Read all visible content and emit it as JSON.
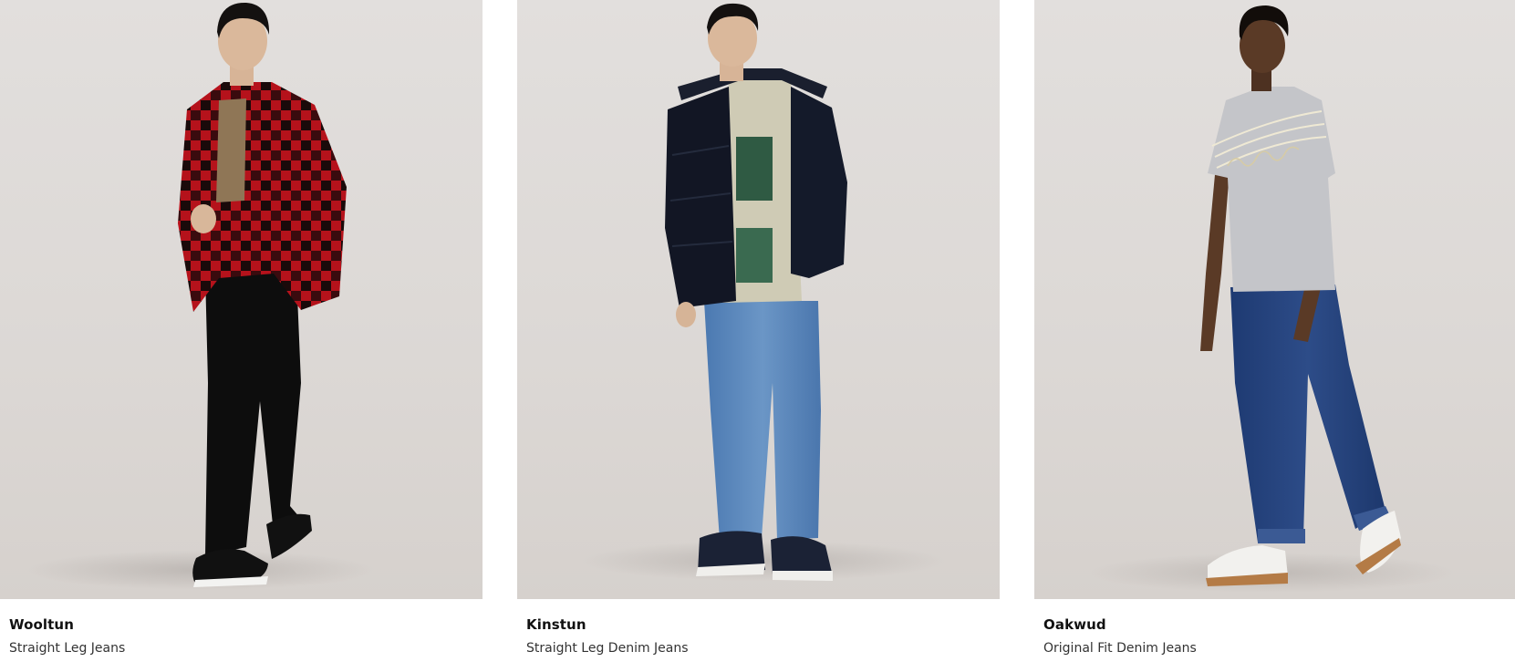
{
  "products": [
    {
      "name": "Wooltun",
      "description": "Straight Leg Jeans"
    },
    {
      "name": "Kinstun",
      "description": "Straight Leg Denim Jeans"
    },
    {
      "name": "Oakwud",
      "description": "Original Fit Denim Jeans"
    }
  ]
}
